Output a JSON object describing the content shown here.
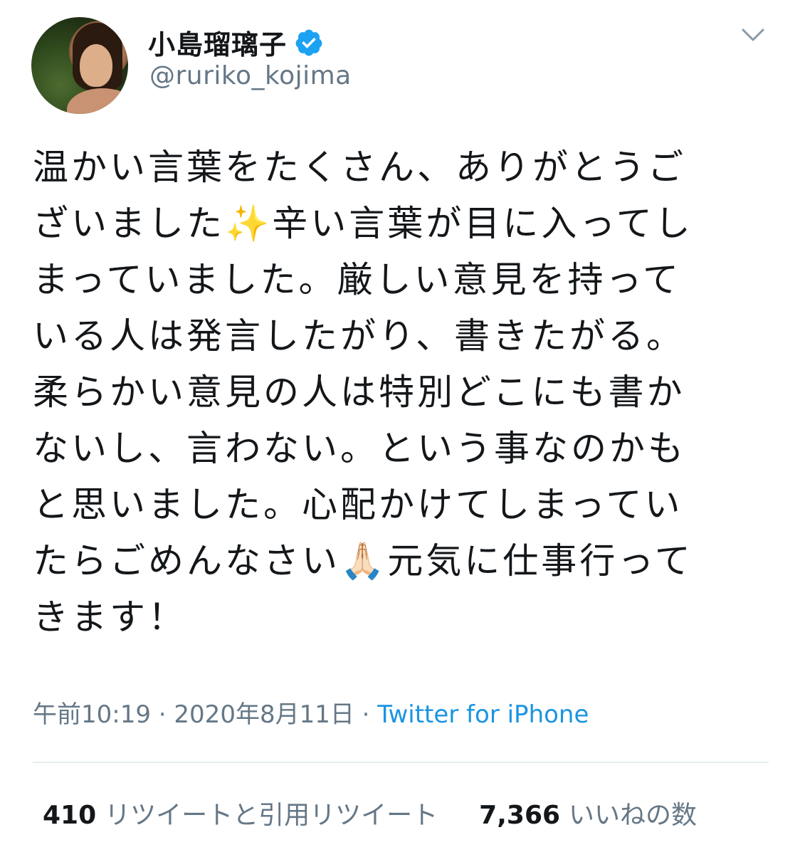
{
  "user": {
    "display_name": "小島瑠璃子",
    "handle": "@ruriko_kojima",
    "verified": true,
    "verified_icon": "verified-badge-icon",
    "avatar_icon": "profile-photo"
  },
  "menu": {
    "icon": "chevron-down-icon"
  },
  "tweet": {
    "lines": [
      "温かい言葉をたくさん、ありがとうご",
      "ざいました✨辛い言葉が目に入ってし",
      "まっていました。厳しい意見を持って",
      "いる人は発言したがり、書きたがる。",
      "柔らかい意見の人は特別どこにも書か",
      "ないし、言わない。という事なのかも",
      "と思いました。心配かけてしまってい",
      "たらごめんなさい🙏🏻元気に仕事行って",
      "きます！"
    ]
  },
  "meta": {
    "time": "午前10:19",
    "separator1": " · ",
    "date": "2020年8月11日",
    "separator2": " · ",
    "source": "Twitter for iPhone"
  },
  "stats": {
    "retweets_count": "410",
    "retweets_label": "リツイートと引用リツイート",
    "likes_count": "7,366",
    "likes_label": "いいねの数"
  },
  "colors": {
    "text": "#14171a",
    "secondary": "#657786",
    "link": "#1b95e0",
    "verified": "#1da1f2",
    "divider": "#e6ecf0"
  }
}
